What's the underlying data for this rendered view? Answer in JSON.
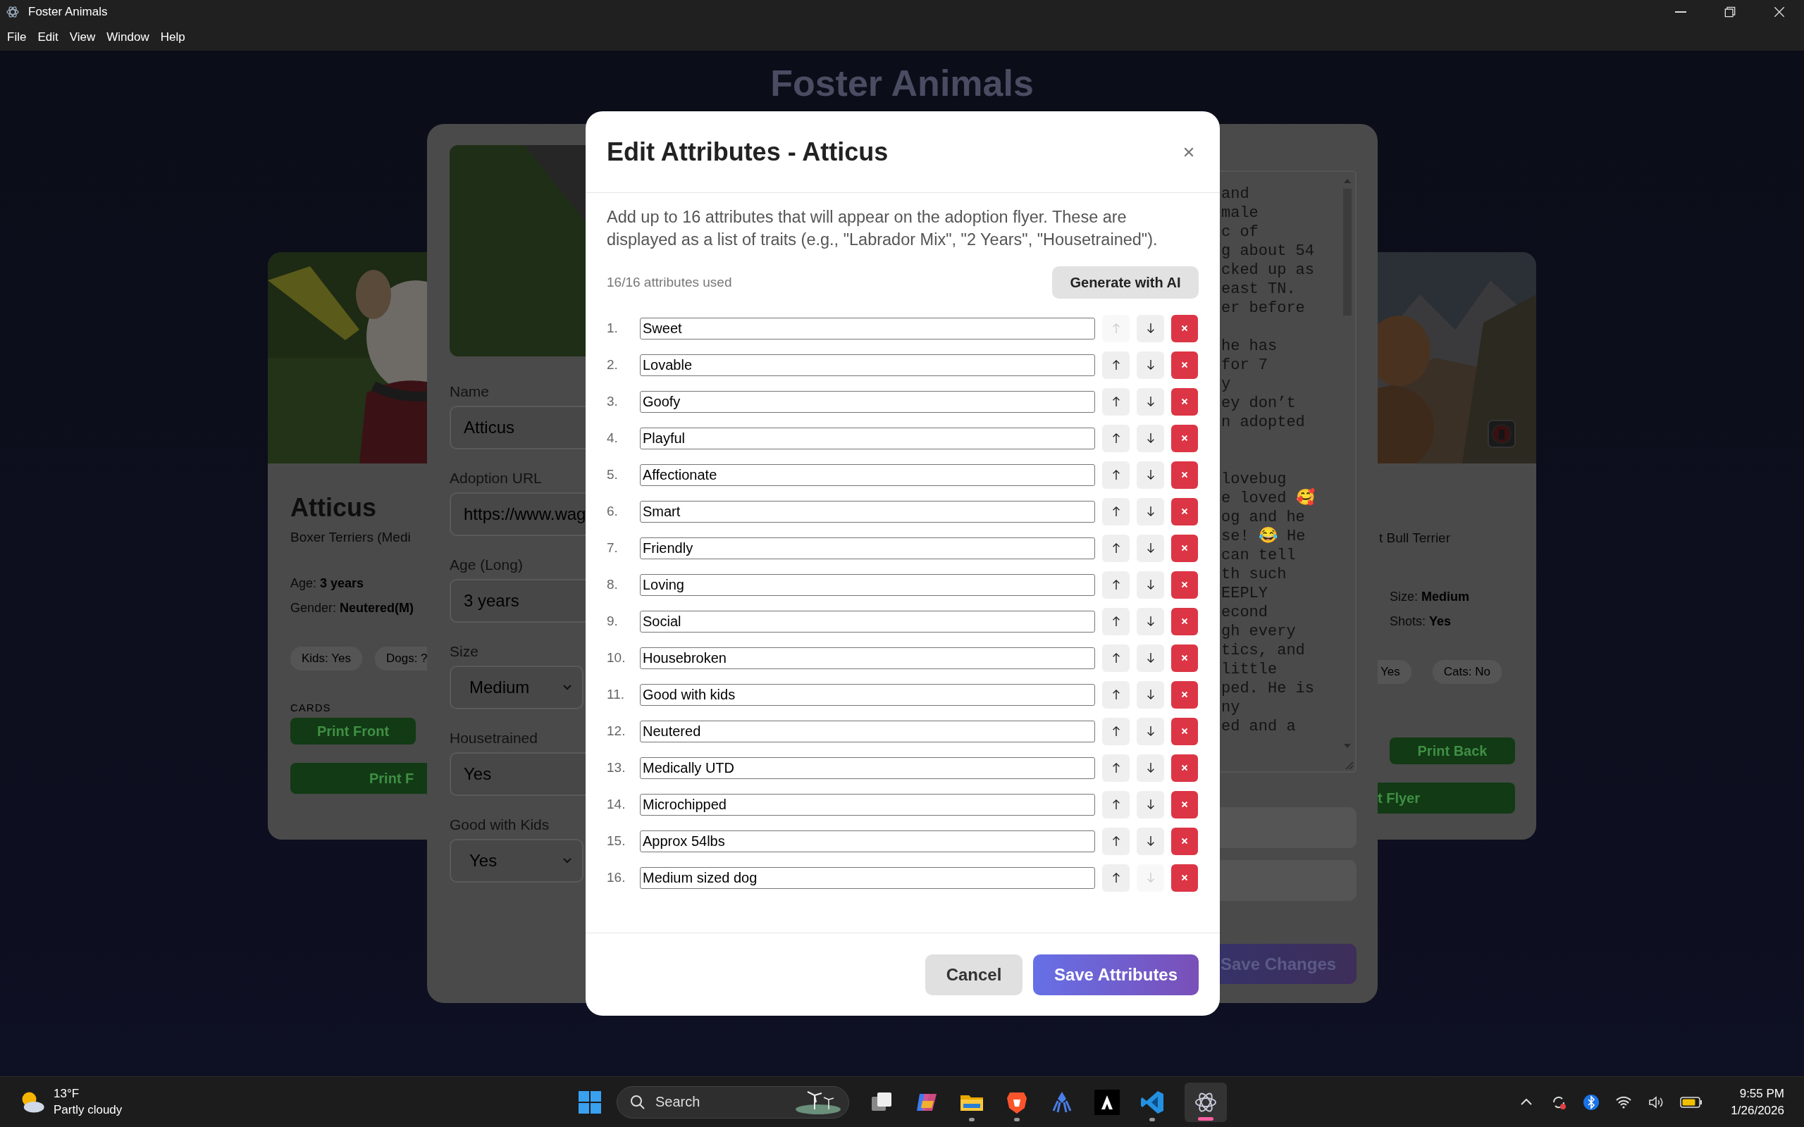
{
  "window": {
    "title": "Foster Animals"
  },
  "menu": [
    "File",
    "Edit",
    "View",
    "Window",
    "Help"
  ],
  "page_title": "Foster Animals",
  "left_card": {
    "name": "Atticus",
    "breed": "Boxer Terriers (Medi",
    "details": [
      {
        "label": "Age:",
        "value": "3 years"
      },
      {
        "label": "Gender:",
        "value": "Neutered(M)"
      }
    ],
    "tags": [
      "Kids: Yes",
      "Dogs: ?"
    ],
    "section": "CARDS",
    "button": "Print Front",
    "wide_button": "Print F"
  },
  "right_card": {
    "breed": "t Bull Terrier",
    "details": [
      {
        "label": "Size:",
        "value": "Medium"
      },
      {
        "label": "Shots:",
        "value": "Yes"
      }
    ],
    "tags": [
      "Yes",
      "Cats: No"
    ],
    "button": "Print Back",
    "wide_button": "t Flyer"
  },
  "edit_panel": {
    "fields": [
      {
        "label": "Name",
        "value": "Atticus",
        "kind": "text"
      },
      {
        "label": "Adoption URL",
        "value": "https://www.wag",
        "kind": "text"
      },
      {
        "label": "Age (Long)",
        "value": "3 years",
        "kind": "text"
      },
      {
        "label": "Size",
        "value": "Medium",
        "kind": "select"
      },
      {
        "label": "Housetrained",
        "value": "Yes",
        "kind": "text"
      },
      {
        "label": "Good with Kids",
        "value": "Yes",
        "kind": "select"
      }
    ],
    "story": "and\nmale\nc of\ng about 54\ncked up as\neast TN.\ner before\n\nhe has\nfor 7\ny\ney don’t\nn adopted\n\n\nlovebug\ne loved 🥰\nog and he\nse! 😂 He\ncan tell\nth such\nEEPLY\necond\ngh every\ntics, and\nlittle\nped. He is\nny\ned and a",
    "save_button": "Save Changes"
  },
  "modal": {
    "title": "Edit Attributes - Atticus",
    "description": "Add up to 16 attributes that will appear on the adoption flyer. These are displayed as a list of traits (e.g., \"Labrador Mix\", \"2 Years\", \"Housetrained\").",
    "usage": "16/16 attributes used",
    "generate_button": "Generate with AI",
    "attributes": [
      {
        "number": "1.",
        "value": "Sweet"
      },
      {
        "number": "2.",
        "value": "Lovable"
      },
      {
        "number": "3.",
        "value": "Goofy"
      },
      {
        "number": "4.",
        "value": "Playful"
      },
      {
        "number": "5.",
        "value": "Affectionate"
      },
      {
        "number": "6.",
        "value": "Smart"
      },
      {
        "number": "7.",
        "value": "Friendly"
      },
      {
        "number": "8.",
        "value": "Loving"
      },
      {
        "number": "9.",
        "value": "Social"
      },
      {
        "number": "10.",
        "value": "Housebroken"
      },
      {
        "number": "11.",
        "value": "Good with kids"
      },
      {
        "number": "12.",
        "value": "Neutered"
      },
      {
        "number": "13.",
        "value": "Medically UTD"
      },
      {
        "number": "14.",
        "value": "Microchipped"
      },
      {
        "number": "15.",
        "value": "Approx 54lbs"
      },
      {
        "number": "16.",
        "value": "Medium sized dog"
      }
    ],
    "cancel_button": "Cancel",
    "save_button": "Save Attributes"
  },
  "taskbar": {
    "weather": {
      "temperature": "13°F",
      "condition": "Partly cloudy"
    },
    "search": {
      "placeholder": "Search"
    },
    "clock": {
      "time": "9:55 PM",
      "date": "1/26/2026"
    }
  }
}
